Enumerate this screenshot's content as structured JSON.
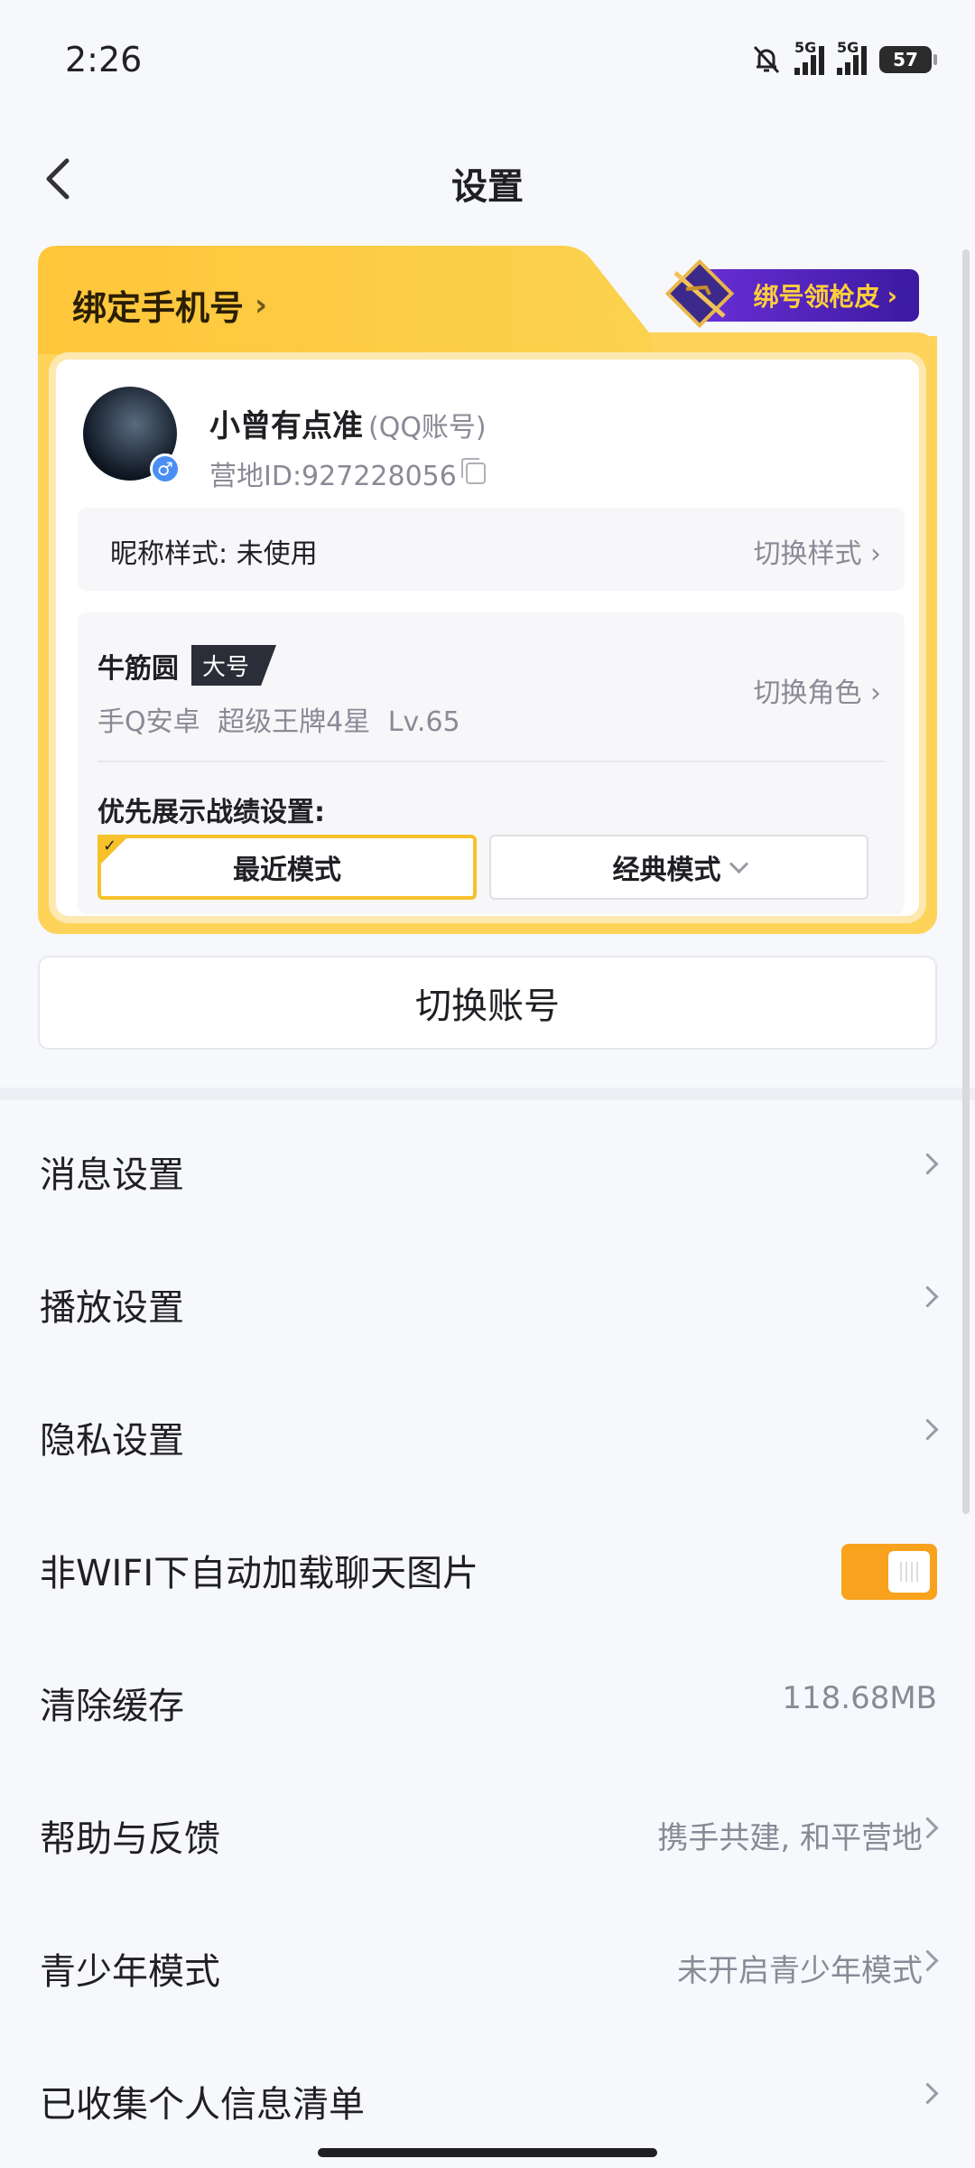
{
  "status": {
    "time": "2:26",
    "sig1": "5G",
    "sig2": "5G",
    "battery": "57"
  },
  "nav": {
    "title": "设置"
  },
  "card": {
    "bind_phone": "绑定手机号",
    "promo": "绑号领枪皮",
    "nickname": "小曾有点准",
    "account_type": "(QQ账号)",
    "camp_id": "营地ID:927228056",
    "nick_style_label": "昵称样式: 未使用",
    "switch_style": "切换样式",
    "role_name": "牛筋圆",
    "role_tag": "大号",
    "role_meta": "手Q安卓  超级王牌4星  Lv.65",
    "switch_role": "切换角色",
    "pref_label": "优先展示战绩设置:",
    "mode_recent": "最近模式",
    "mode_classic": "经典模式"
  },
  "switch_account": "切换账号",
  "settings": [
    {
      "label": "消息设置",
      "value": ""
    },
    {
      "label": "播放设置",
      "value": ""
    },
    {
      "label": "隐私设置",
      "value": ""
    },
    {
      "label": "非WIFI下自动加载聊天图片",
      "value": "",
      "toggle_on": true
    },
    {
      "label": "清除缓存",
      "value": "118.68MB"
    },
    {
      "label": "帮助与反馈",
      "value": "携手共建, 和平营地"
    },
    {
      "label": "青少年模式",
      "value": "未开启青少年模式"
    },
    {
      "label": "已收集个人信息清单",
      "value": ""
    }
  ],
  "colors": {
    "accent": "#f8a21d",
    "card_gold": "#fdd459",
    "promo_purple": "#5b26c7"
  }
}
